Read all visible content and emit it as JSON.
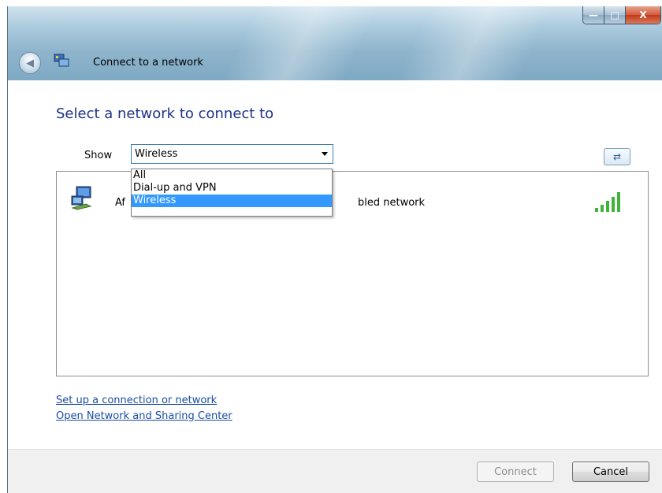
{
  "window": {
    "title": "Connect to a network",
    "caption_buttons": {
      "minimize": "—",
      "maximize": "□",
      "close": "X"
    }
  },
  "main": {
    "heading": "Select a network to connect to",
    "show_label": "Show",
    "show_value": "Wireless",
    "dropdown_options": [
      "All",
      "Dial-up and VPN",
      "Wireless"
    ],
    "dropdown_selected_index": 2,
    "network": {
      "name": "Af",
      "status": "bled network",
      "signal_bars": 5
    }
  },
  "links": {
    "setup": "Set up a connection or network",
    "sharing_center": "Open Network and Sharing Center"
  },
  "footer": {
    "connect": "Connect",
    "cancel": "Cancel"
  },
  "icons": {
    "back": "back-arrow-icon",
    "network_title": "network-icon",
    "refresh": "refresh-icon",
    "computer": "network-computer-icon",
    "signal": "signal-strength-icon"
  }
}
